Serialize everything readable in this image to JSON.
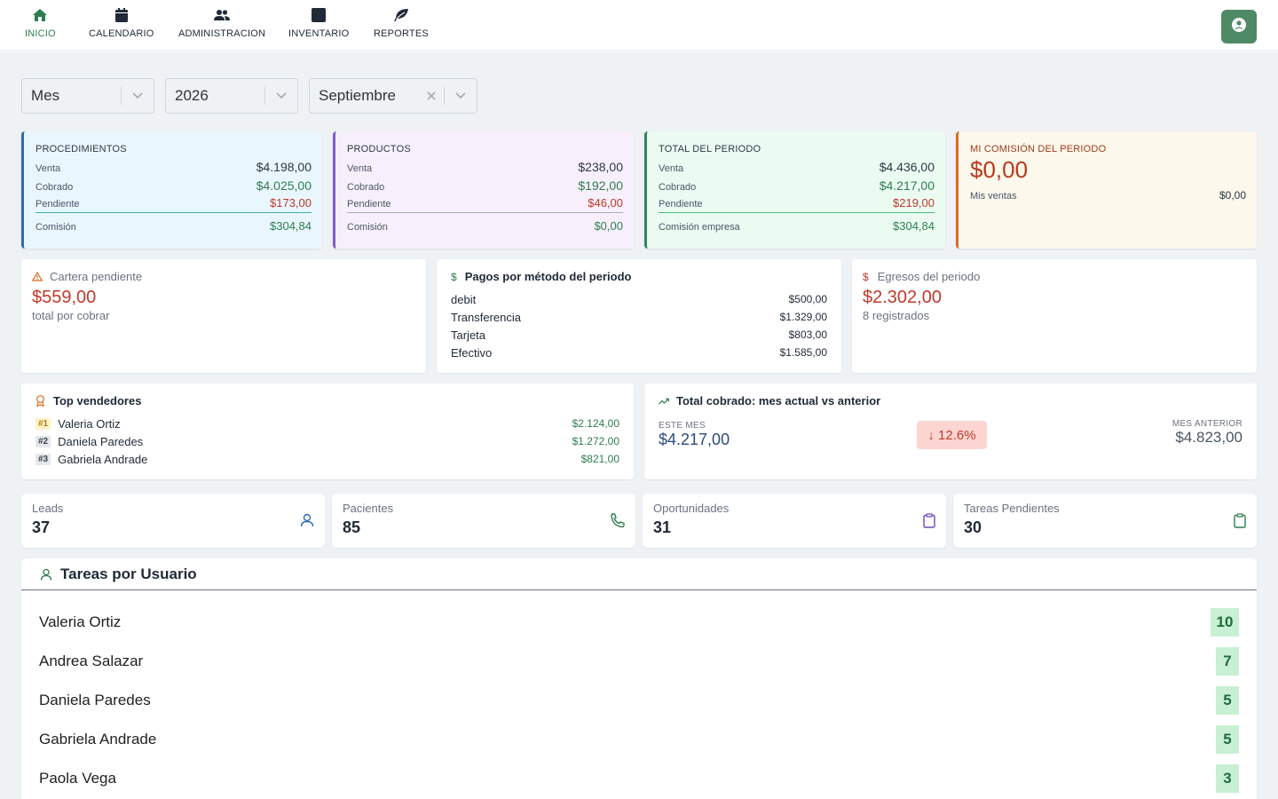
{
  "nav": {
    "items": [
      {
        "label": "INICIO",
        "icon": "home-icon"
      },
      {
        "label": "CALENDARIO",
        "icon": "calendar-icon"
      },
      {
        "label": "ADMINISTRACION",
        "icon": "users-icon"
      },
      {
        "label": "INVENTARIO",
        "icon": "box-icon"
      },
      {
        "label": "REPORTES",
        "icon": "leaf-icon"
      }
    ],
    "active": "INICIO",
    "accent_color": "#2e7d4f",
    "user_icon": "user-circle-icon",
    "user_button_color": "#4f8a66"
  },
  "filters": {
    "period": "Mes",
    "year": "2026",
    "month": "Septiembre"
  },
  "cards": {
    "procedimientos": {
      "title": "PROCEDIMIENTOS",
      "venta_label": "Venta",
      "venta": "$4.198,00",
      "cobrado_label": "Cobrado",
      "cobrado": "$4.025,00",
      "pendiente_label": "Pendiente",
      "pendiente": "$173,00",
      "comision_label": "Comisión",
      "comision": "$304,84"
    },
    "productos": {
      "title": "PRODUCTOS",
      "venta_label": "Venta",
      "venta": "$238,00",
      "cobrado_label": "Cobrado",
      "cobrado": "$192,00",
      "pendiente_label": "Pendiente",
      "pendiente": "$46,00",
      "comision_label": "Comisión",
      "comision": "$0,00"
    },
    "total": {
      "title": "TOTAL DEL PERIODO",
      "venta_label": "Venta",
      "venta": "$4.436,00",
      "cobrado_label": "Cobrado",
      "cobrado": "$4.217,00",
      "pendiente_label": "Pendiente",
      "pendiente": "$219,00",
      "comision_label": "Comisión empresa",
      "comision": "$304,84"
    },
    "mi_comision": {
      "title": "MI COMISIÓN DEL PERIODO",
      "amount": "$0,00",
      "ventas_label": "Mis ventas",
      "ventas": "$0,00"
    }
  },
  "cartera": {
    "title": "Cartera pendiente",
    "amount": "$559,00",
    "subtitle": "total por cobrar"
  },
  "pagos": {
    "title": "Pagos por método del periodo",
    "rows": [
      {
        "method": "debit",
        "amount": "$500,00"
      },
      {
        "method": "Transferencia",
        "amount": "$1.329,00"
      },
      {
        "method": "Tarjeta",
        "amount": "$803,00"
      },
      {
        "method": "Efectivo",
        "amount": "$1.585,00"
      }
    ]
  },
  "egresos": {
    "title": "Egresos del periodo",
    "amount": "$2.302,00",
    "subtitle": "8 registrados"
  },
  "top_vendedores": {
    "title": "Top vendedores",
    "rows": [
      {
        "rank": "#1",
        "name": "Valeria Ortiz",
        "amount": "$2.124,00"
      },
      {
        "rank": "#2",
        "name": "Daniela Paredes",
        "amount": "$1.272,00"
      },
      {
        "rank": "#3",
        "name": "Gabriela Andrade",
        "amount": "$821,00"
      }
    ]
  },
  "comparativo": {
    "title": "Total cobrado: mes actual vs anterior",
    "actual_label": "ESTE MES",
    "actual": "$4.217,00",
    "change": "↓ 12.6%",
    "anterior_label": "MES ANTERIOR",
    "anterior": "$4.823,00"
  },
  "stats": [
    {
      "label": "Leads",
      "value": "37",
      "icon": "user-icon",
      "color": "#2b6cb0"
    },
    {
      "label": "Pacientes",
      "value": "85",
      "icon": "phone-icon",
      "color": "#2e7d4f"
    },
    {
      "label": "Oportunidades",
      "value": "31",
      "icon": "clipboard-icon",
      "color": "#6b46c1"
    },
    {
      "label": "Tareas Pendientes",
      "value": "30",
      "icon": "clipboard-icon",
      "color": "#2e7d4f"
    }
  ],
  "tareas": {
    "title": "Tareas por Usuario",
    "rows": [
      {
        "name": "Valeria Ortiz",
        "count": "10"
      },
      {
        "name": "Andrea Salazar",
        "count": "7"
      },
      {
        "name": "Daniela Paredes",
        "count": "5"
      },
      {
        "name": "Gabriela Andrade",
        "count": "5"
      },
      {
        "name": "Paola Vega",
        "count": "3"
      }
    ]
  }
}
